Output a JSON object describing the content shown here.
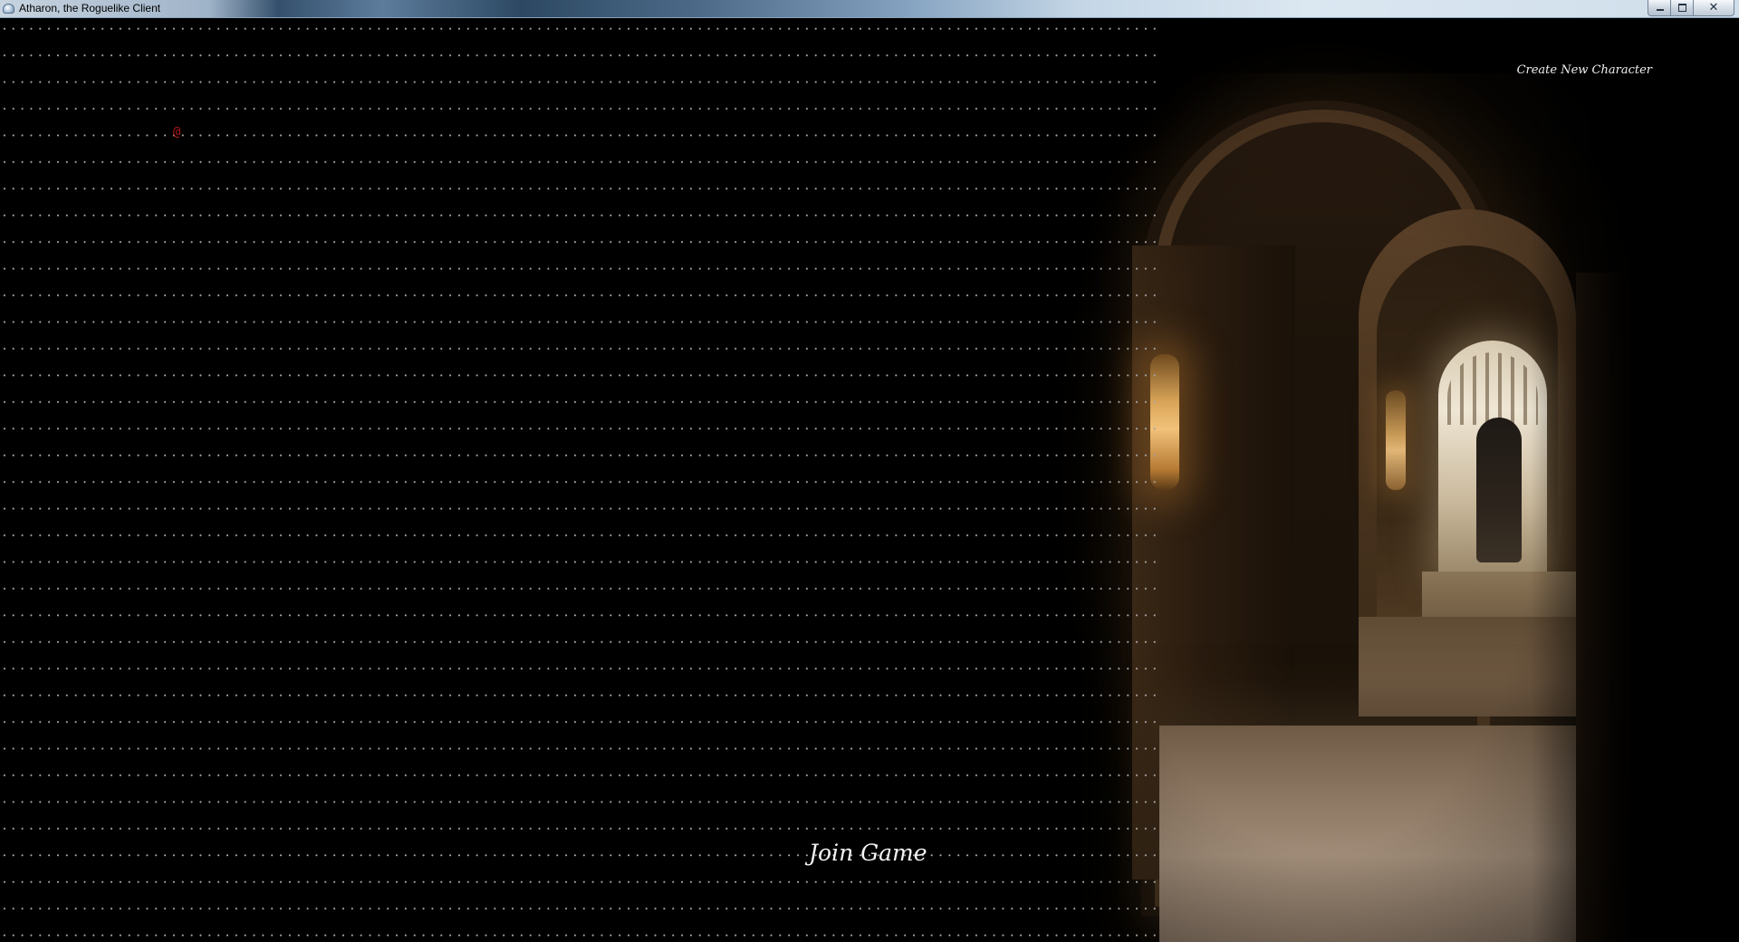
{
  "window": {
    "title": "Atharon, the Roguelike Client",
    "close_glyph": "✕"
  },
  "game": {
    "player_glyph": "@",
    "menu": {
      "create_character_label": "Create New Character",
      "join_game_label": "Join Game"
    }
  },
  "icons": {
    "app": "app-icon",
    "minimize": "minimize-icon",
    "maximize": "maximize-icon",
    "close": "close-icon"
  },
  "colors": {
    "background": "#000000",
    "grid_dot": "#a3a3a3",
    "player_glyph": "#b01818",
    "menu_text": "#f0f0f0"
  }
}
